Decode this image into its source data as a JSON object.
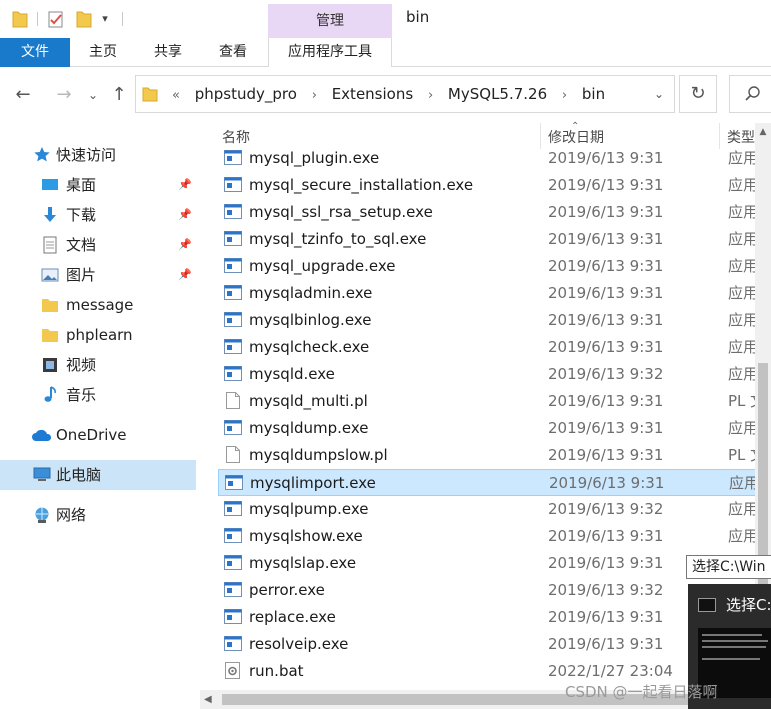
{
  "titlebar": {
    "manage_label": "管理",
    "window_title": "bin"
  },
  "ribbon": {
    "tabs": [
      "文件",
      "主页",
      "共享",
      "查看",
      "应用程序工具"
    ]
  },
  "nav": {
    "address": {
      "overflow": "«",
      "crumbs": [
        "phpstudy_pro",
        "Extensions",
        "MySQL5.7.26",
        "bin"
      ]
    }
  },
  "navpane": {
    "quick_access": "快速访问",
    "items": [
      "桌面",
      "下载",
      "文档",
      "图片",
      "message",
      "phplearn",
      "视频",
      "音乐"
    ],
    "onedrive": "OneDrive",
    "this_pc": "此电脑",
    "network": "网络"
  },
  "columns": {
    "name": "名称",
    "date": "修改日期",
    "type": "类型"
  },
  "files": [
    {
      "name": "mysql_plugin.exe",
      "date": "2019/6/13 9:31",
      "type": "应用",
      "kind": "exe"
    },
    {
      "name": "mysql_secure_installation.exe",
      "date": "2019/6/13 9:31",
      "type": "应用",
      "kind": "exe"
    },
    {
      "name": "mysql_ssl_rsa_setup.exe",
      "date": "2019/6/13 9:31",
      "type": "应用",
      "kind": "exe"
    },
    {
      "name": "mysql_tzinfo_to_sql.exe",
      "date": "2019/6/13 9:31",
      "type": "应用",
      "kind": "exe"
    },
    {
      "name": "mysql_upgrade.exe",
      "date": "2019/6/13 9:31",
      "type": "应用",
      "kind": "exe"
    },
    {
      "name": "mysqladmin.exe",
      "date": "2019/6/13 9:31",
      "type": "应用",
      "kind": "exe"
    },
    {
      "name": "mysqlbinlog.exe",
      "date": "2019/6/13 9:31",
      "type": "应用",
      "kind": "exe"
    },
    {
      "name": "mysqlcheck.exe",
      "date": "2019/6/13 9:31",
      "type": "应用",
      "kind": "exe"
    },
    {
      "name": "mysqld.exe",
      "date": "2019/6/13 9:32",
      "type": "应用",
      "kind": "exe"
    },
    {
      "name": "mysqld_multi.pl",
      "date": "2019/6/13 9:31",
      "type": "PL 文",
      "kind": "doc"
    },
    {
      "name": "mysqldump.exe",
      "date": "2019/6/13 9:31",
      "type": "应用",
      "kind": "exe"
    },
    {
      "name": "mysqldumpslow.pl",
      "date": "2019/6/13 9:31",
      "type": "PL 文",
      "kind": "doc"
    },
    {
      "name": "mysqlimport.exe",
      "date": "2019/6/13 9:31",
      "type": "应用",
      "kind": "exe",
      "selected": true
    },
    {
      "name": "mysqlpump.exe",
      "date": "2019/6/13 9:32",
      "type": "应用",
      "kind": "exe"
    },
    {
      "name": "mysqlshow.exe",
      "date": "2019/6/13 9:31",
      "type": "应用",
      "kind": "exe"
    },
    {
      "name": "mysqlslap.exe",
      "date": "2019/6/13 9:31",
      "type": "",
      "kind": "exe"
    },
    {
      "name": "perror.exe",
      "date": "2019/6/13 9:32",
      "type": "",
      "kind": "exe"
    },
    {
      "name": "replace.exe",
      "date": "2019/6/13 9:31",
      "type": "",
      "kind": "exe"
    },
    {
      "name": "resolveip.exe",
      "date": "2019/6/13 9:31",
      "type": "",
      "kind": "exe"
    },
    {
      "name": "run.bat",
      "date": "2022/1/27 23:04",
      "type": "",
      "kind": "bat"
    }
  ],
  "tooltip": "选择C:\\Win",
  "cmd_preview": {
    "title": "选择C:"
  },
  "watermark": "CSDN @一起看日落啊",
  "colors": {
    "accent": "#1979ca",
    "manage_tab": "#e8d7f5",
    "selection": "#cce8ff",
    "selection_border": "#99d1ff"
  }
}
